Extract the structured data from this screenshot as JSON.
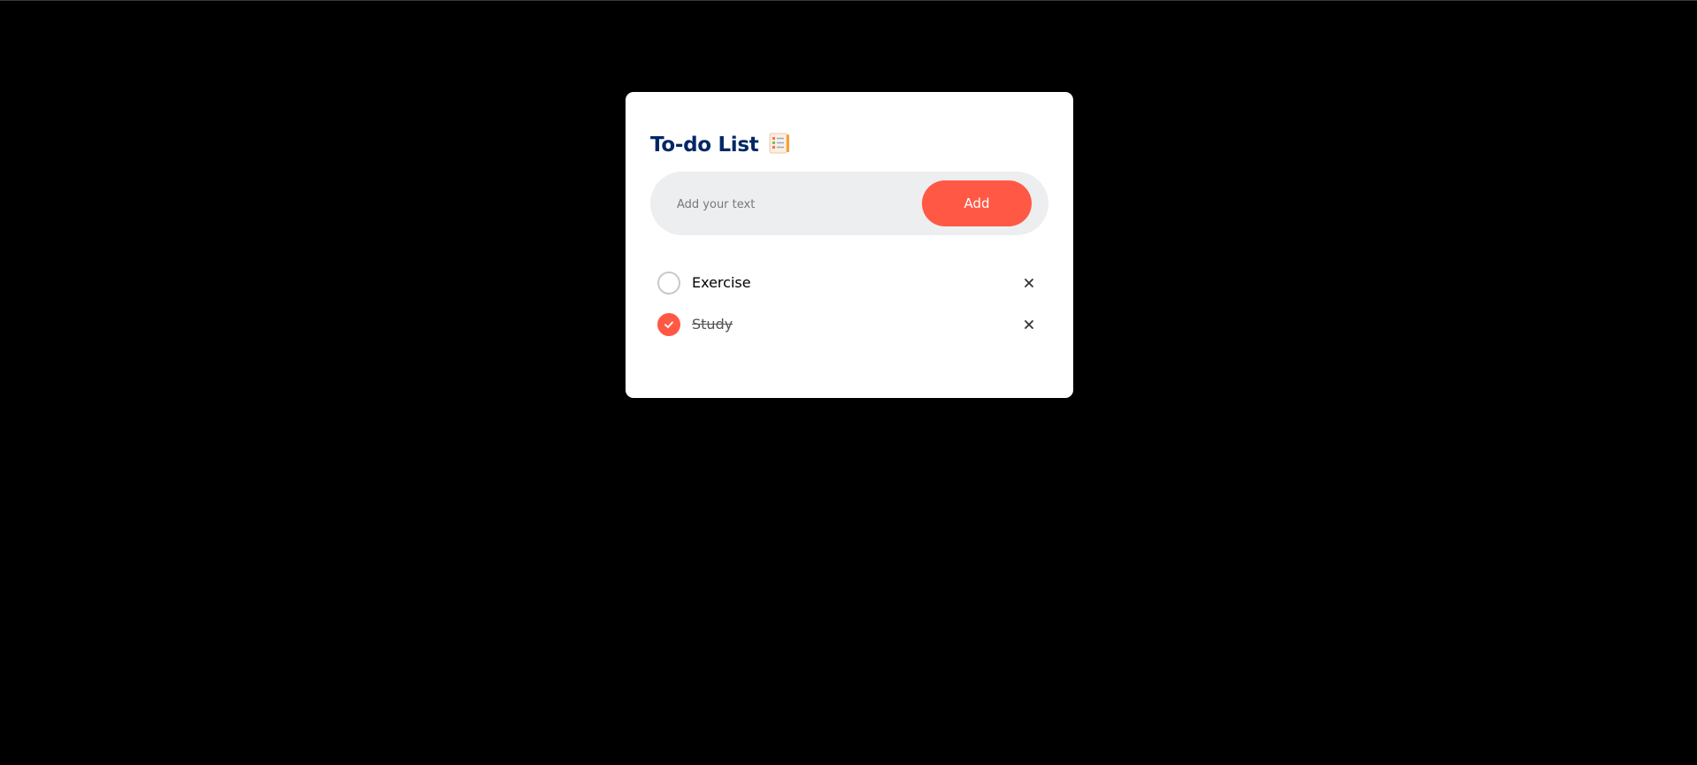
{
  "app": {
    "title": "To-do List",
    "title_icon": "checklist-notepad-icon"
  },
  "input": {
    "placeholder": "Add your text",
    "value": ""
  },
  "add_button": {
    "label": "Add"
  },
  "todos": [
    {
      "text": "Exercise",
      "checked": false,
      "delete_icon": "close-icon"
    },
    {
      "text": "Study",
      "checked": true,
      "delete_icon": "close-icon"
    }
  ],
  "colors": {
    "background": "#000000",
    "card": "#ffffff",
    "title": "#002765",
    "accent": "#ff5945",
    "input_bg": "#edeef0"
  }
}
